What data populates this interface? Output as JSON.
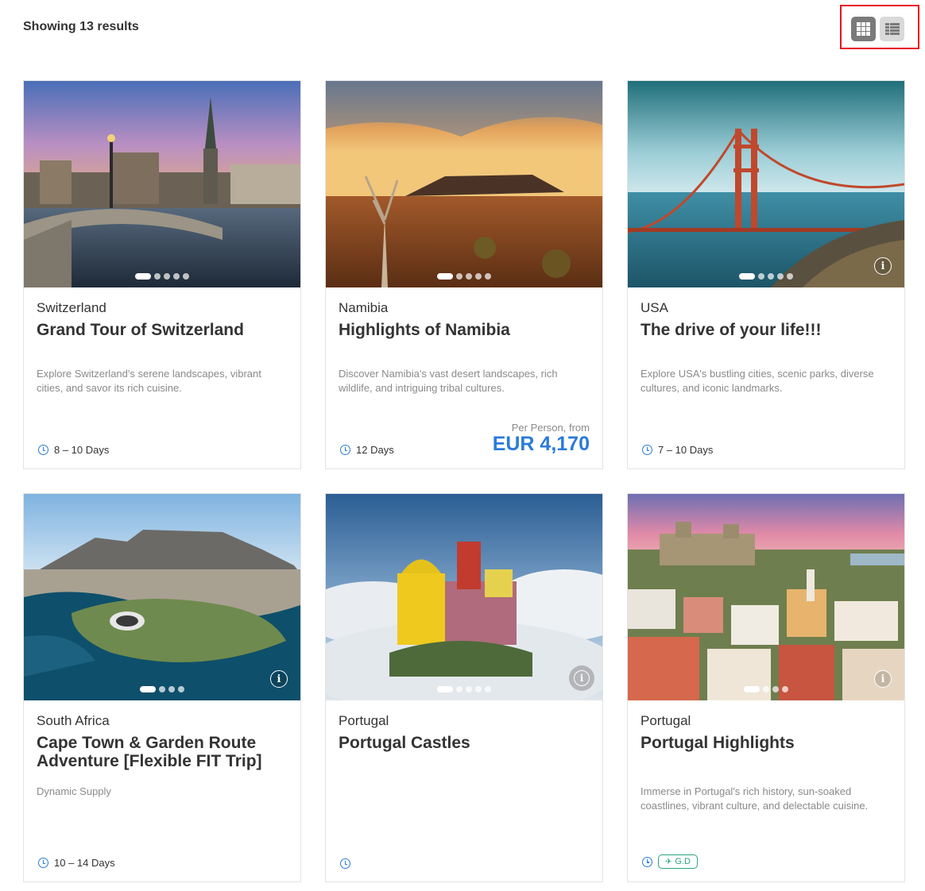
{
  "header": {
    "results_text": "Showing 13 results"
  },
  "view_toggle": {
    "active": "grid",
    "options": [
      "grid",
      "list"
    ]
  },
  "colors": {
    "accent": "#2a7bd9",
    "badge_green": "#2aa37a",
    "toggle_outline": "#e8121e"
  },
  "cards": [
    {
      "country": "Switzerland",
      "title": "Grand Tour of Switzerland",
      "description": "Explore Switzerland's serene landscapes, vibrant cities, and savor its rich cuisine.",
      "duration": "8 – 10 Days"
    },
    {
      "country": "Namibia",
      "title": "Highlights of Namibia",
      "description": "Discover Namibia's vast desert landscapes, rich wildlife, and intriguing tribal cultures.",
      "duration": "12 Days",
      "price_label": "Per Person, from",
      "price": "EUR 4,170"
    },
    {
      "country": "USA",
      "title": "The drive of your life!!!",
      "description": "Explore USA's bustling cities, scenic parks, diverse cultures, and iconic landmarks.",
      "duration": "7 – 10 Days"
    },
    {
      "country": "South Africa",
      "title": "Cape Town & Garden Route Adventure [Flexible FIT Trip]",
      "description": "Dynamic Supply",
      "duration": "10 – 14 Days"
    },
    {
      "country": "Portugal",
      "title": "Portugal Castles",
      "description": "",
      "duration": ""
    },
    {
      "country": "Portugal",
      "title": "Portugal Highlights",
      "description": "Immerse in Portugal's rich history, sun-soaked coastlines, vibrant culture, and delectable cuisine.",
      "badge": "G.D"
    }
  ]
}
